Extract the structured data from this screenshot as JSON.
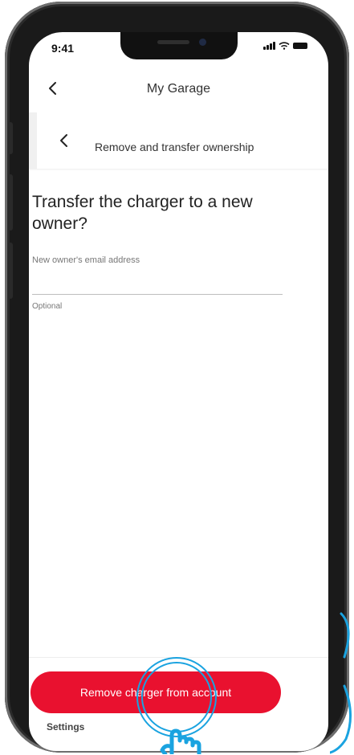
{
  "status_bar": {
    "time": "9:41"
  },
  "nav": {
    "title": "My Garage"
  },
  "sub_header": {
    "title": "Remove and transfer ownership"
  },
  "form": {
    "heading": "Transfer the charger to a new owner?",
    "email_label": "New owner's email address",
    "email_value": "",
    "hint": "Optional"
  },
  "actions": {
    "remove_label": "Remove charger from account"
  },
  "background_peek": {
    "text": "Settings"
  },
  "colors": {
    "accent": "#e9112f",
    "touch_indicator": "#1aa3e0"
  },
  "icons": {
    "back": "chevron-left-icon",
    "touch": "hand-pointer-icon"
  }
}
